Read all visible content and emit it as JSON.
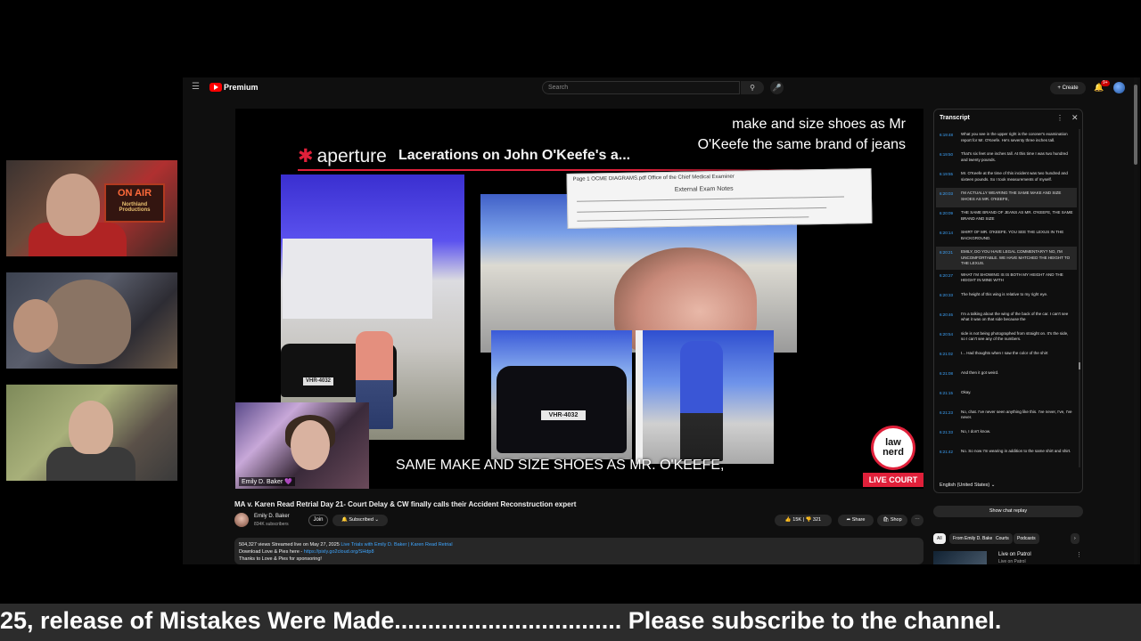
{
  "cams": {
    "onair_sign": "ON AIR",
    "onair_sub": "Northland Productions"
  },
  "browser": {
    "brand": "Premium",
    "search_placeholder": "Search",
    "create_label": "+ Create",
    "notification_count": "9+"
  },
  "video": {
    "slide_logo": "aperture",
    "slide_title": "Lacerations on John O'Keefe's a...",
    "doc_header": "Page 1 OCME DIAGRAMS.pdf    Office of the Chief Medical Examiner",
    "doc_sub": "External Exam Notes",
    "plate1": "VHR-4032",
    "plate2": "VHR-4032",
    "subtitle_top_1": "make and size shoes as Mr",
    "subtitle_top_2": "O'Keefe the same brand of jeans",
    "subtitle_bottom": "SAME MAKE AND SIZE SHOES AS MR. O'KEEFE,",
    "pip_name": "Emily D. Baker 💜",
    "lawnerd": "law nerd",
    "live_badge": "LIVE COURT"
  },
  "info": {
    "title": "MA v. Karen Read Retrial Day 21- Court Delay & CW finally calls their Accident Reconstruction expert",
    "channel": "Emily D. Baker",
    "subscribers": "834K subscribers",
    "join": "Join",
    "subscribed": "🔔 Subscribed ⌄",
    "likes": "👍 15K  |  👎 321",
    "share": "➦ Share",
    "shop": "🛍 Shop",
    "more": "⋯",
    "desc_line1_a": "504,327 views  Streamed live on May 27, 2025",
    "desc_line1_b": "Live Trials with Emily D. Baker | Karen Read Retrial",
    "desc_line2_a": "Download Love & Pies here - ",
    "desc_line2_b": "https://pixly.go2cloud.org/SHdp8",
    "desc_line3": "Thanks to Love & Pies for sponsoring!"
  },
  "transcript": {
    "heading": "Transcript",
    "segments": [
      {
        "ts": "6:19:48",
        "text": "What you see in the upper right is the coroner's examination report for Mr. O'Keefe. He's seventy three inches tall."
      },
      {
        "ts": "6:19:50",
        "text": "That's six feet one inches tall. At this time I was two hundred and twenty pounds."
      },
      {
        "ts": "6:19:55",
        "text": "Mr. O'Keefe at the time of this incident was two hundred and sixteen pounds. So I took measurements of myself."
      },
      {
        "ts": "6:20:03",
        "text": "I'M ACTUALLY WEARING THE SAME MAKE AND SIZE SHOES AS MR. O'KEEFE,",
        "active": true
      },
      {
        "ts": "6:20:09",
        "text": "THE SAME BRAND OF JEANS AS MR. O'KEEFE, THE SAME BRAND AND SIZE"
      },
      {
        "ts": "6:20:14",
        "text": "SHIRT OF MR. O'KEEFE. YOU SEE THE LEXUS IN THE BACKGROUND."
      },
      {
        "ts": "6:20:21",
        "text": "EMILY, DO YOU HAVE LEGAL COMMENTARY? NO, I'M UNCOMFORTABLE. WE HAVE MATCHED THE HEIGHT TO THE LEXUS.",
        "active": true
      },
      {
        "ts": "6:20:27",
        "text": "WHAT I'M SHOWING IS IS BOTH MY HEIGHT AND THE HEIGHT IN MINE WITH"
      },
      {
        "ts": "6:20:33",
        "text": "The height of this wing is relative to my right eye."
      },
      {
        "ts": "6:20:46",
        "text": "I'm a talking about the wing of the back of the car. I can't see what it was on that side because the"
      },
      {
        "ts": "6:20:54",
        "text": "side is not being photographed from straight on. It's the side, so I can't see any of the numbers."
      },
      {
        "ts": "6:21:02",
        "text": "I... Had thoughts when I saw the color of the shirt"
      },
      {
        "ts": "6:21:08",
        "text": "And then it got weird."
      },
      {
        "ts": "6:21:15",
        "text": "Okay."
      },
      {
        "ts": "6:21:23",
        "text": "No, chat. I've never seen anything like this. I've never, I've, I've never."
      },
      {
        "ts": "6:21:33",
        "text": "No, I don't know."
      },
      {
        "ts": "6:21:42",
        "text": "No. So now I'm wearing in addition to the same shirt and shirt."
      }
    ],
    "language": "English (United States) ⌄",
    "chat_replay": "Show chat replay",
    "chips": [
      "All",
      "From Emily D. Baker",
      "Courts",
      "Podcasts",
      "›"
    ],
    "rec_title": "Live on Patrol",
    "rec_sub": "Live on Patrol"
  },
  "ticker": {
    "text": "25, release of Mistakes Were Made.................................. Please subscribe to the channel."
  }
}
